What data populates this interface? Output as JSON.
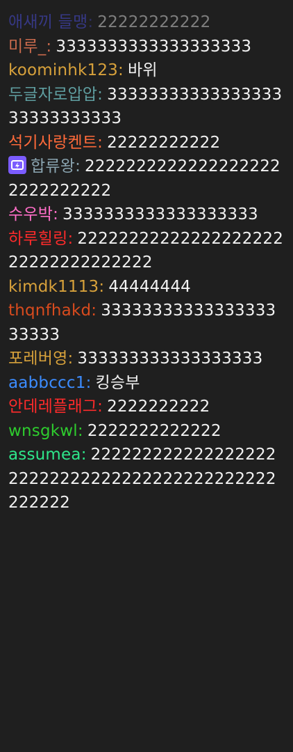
{
  "chat": {
    "messages": [
      {
        "user": "애새끼 들맹",
        "text": "22222222222",
        "color": "#4a4dd8",
        "dim": true
      },
      {
        "user": "미루_",
        "text": "3333333333333333333",
        "color": "#c96a4c"
      },
      {
        "user": "koominhk123",
        "text": "바위",
        "color": "#d7a13b"
      },
      {
        "user": "두글자로압압",
        "text": "3333333333333333333333333333",
        "color": "#5f9ea0"
      },
      {
        "user": "석기사랑켄트",
        "text": "22222222222",
        "color": "#ff6a3a"
      },
      {
        "user": "합류왕",
        "text": "22222222222222222222222222222",
        "color": "#8aa4b0",
        "badge": true
      },
      {
        "user": "수우박",
        "text": "3333333333333333333",
        "color": "#ff6ec7"
      },
      {
        "user": "하루힐링",
        "text": "2222222222222222222222222222222222",
        "color": "#ff2b2b"
      },
      {
        "user": "kimdk1113",
        "text": "44444444",
        "color": "#d7a13b"
      },
      {
        "user": "thqnfhakd",
        "text": "3333333333333333333333",
        "color": "#d84b1e"
      },
      {
        "user": "포레버영",
        "text": "333333333333333333",
        "color": "#d7a13b"
      },
      {
        "user": "aabbccc1",
        "text": "킹승부",
        "color": "#3c8cff"
      },
      {
        "user": "안데레플래그",
        "text": "2222222222",
        "color": "#ff2b2b"
      },
      {
        "user": "wnsgkwl",
        "text": "2222222222222",
        "color": "#2ecc2e"
      },
      {
        "user": "assumea",
        "text": "22222222222222222222222222222222222222222222222222",
        "color": "#2ee68a"
      }
    ],
    "colon": ":"
  }
}
